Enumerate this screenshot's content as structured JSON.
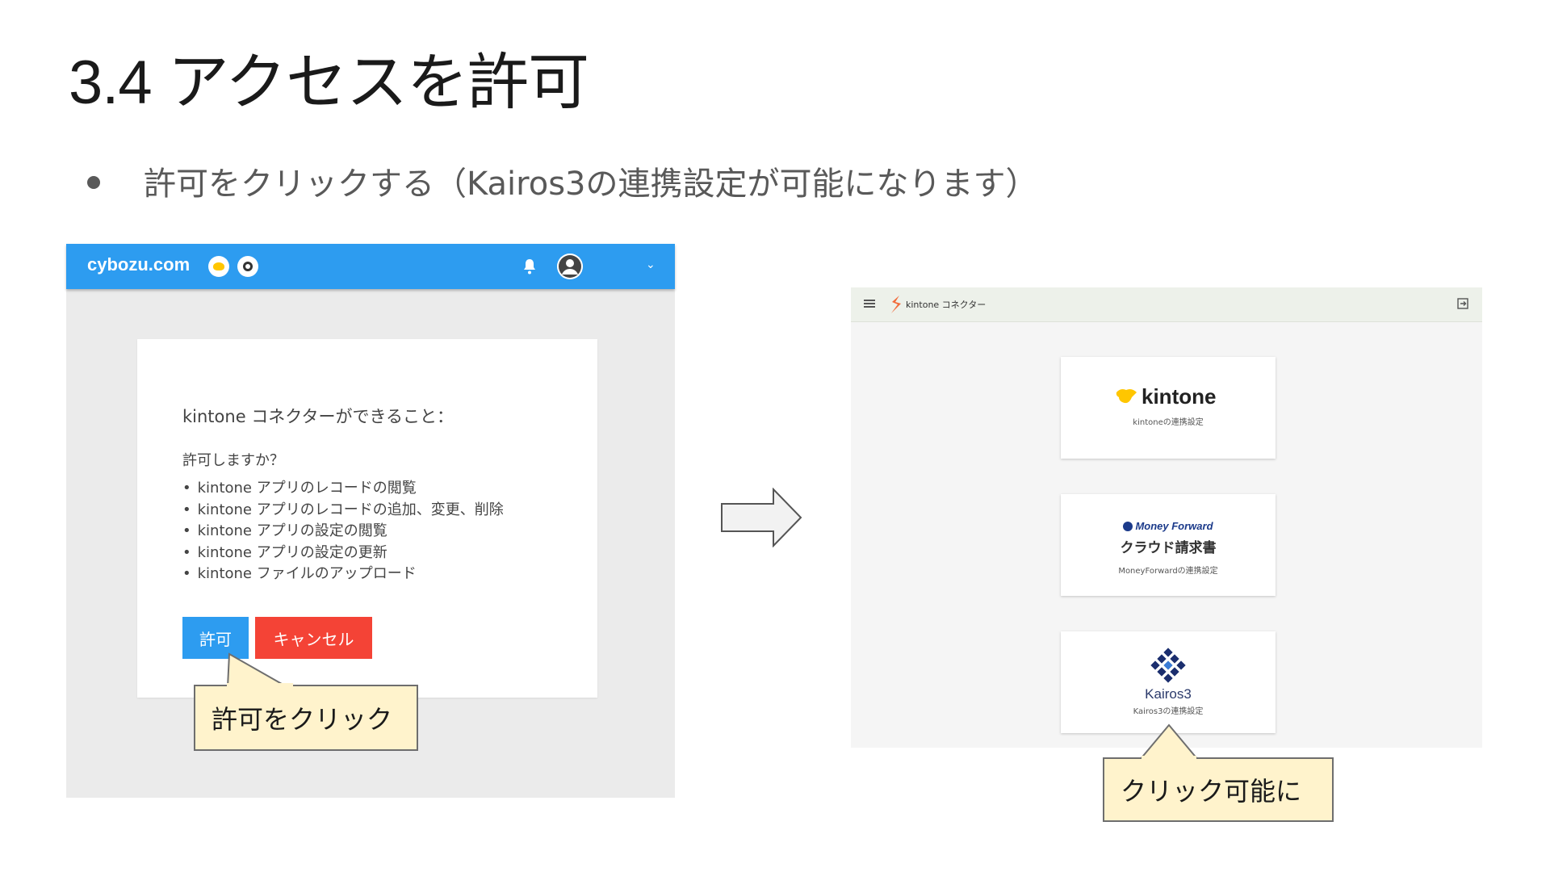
{
  "slide": {
    "title": "3.4 アクセスを許可",
    "bullet": "許可をクリックする（Kairos3の連携設定が可能になります）"
  },
  "left_screen": {
    "header": {
      "logo": "cybozu.com",
      "icons": [
        "kintone-icon",
        "gear-icon",
        "bell-icon",
        "user-avatar-icon",
        "chevron-down-icon"
      ]
    },
    "dialog": {
      "title": "kintone コネクターができること：",
      "question": "許可しますか？",
      "permissions": [
        "kintone アプリのレコードの閲覧",
        "kintone アプリのレコードの追加、変更、削除",
        "kintone アプリの設定の閲覧",
        "kintone アプリの設定の更新",
        "kintone ファイルのアップロード"
      ],
      "allow_label": "許可",
      "cancel_label": "キャンセル"
    },
    "callout": "許可をクリック"
  },
  "right_screen": {
    "header": {
      "title": "kintone コネクター",
      "icons": [
        "menu-icon",
        "logout-icon"
      ]
    },
    "cards": [
      {
        "name": "kintone",
        "sub": "kintoneの連携設定"
      },
      {
        "brand": "Money Forward",
        "name": "クラウド請求書",
        "sub": "MoneyForwardの連携設定"
      },
      {
        "name": "Kairos3",
        "sub": "Kairos3の連携設定"
      }
    ],
    "callout": "クリック可能に"
  },
  "colors": {
    "cybozu_header": "#2d9cf0",
    "allow_button": "#2d9cf0",
    "cancel_button": "#f44336",
    "callout_fill": "#fff3cc",
    "kintone_yellow": "#ffc600",
    "kairos_navy": "#1b2e6e"
  }
}
